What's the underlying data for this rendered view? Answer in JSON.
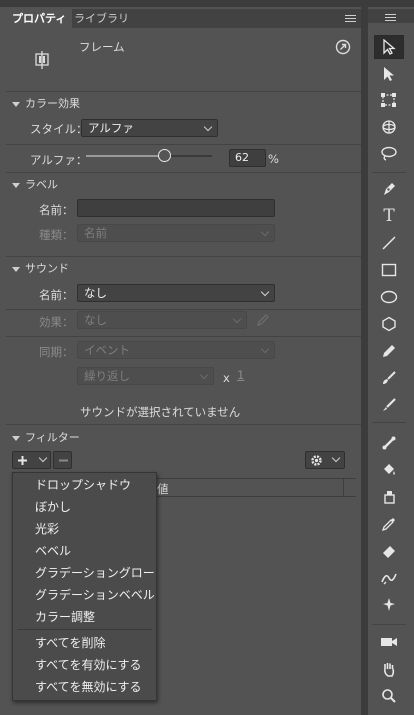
{
  "tabs": [
    {
      "label": "プロパティ"
    },
    {
      "label": "ライブラリ"
    }
  ],
  "header": {
    "object_label": "フレーム"
  },
  "color_effect": {
    "section_title": "カラー効果",
    "style_label": "スタイル：",
    "style_value": "アルファ",
    "alpha_label": "アルファ：",
    "alpha_value": "62",
    "alpha_unit": "%",
    "alpha_fraction": 0.62
  },
  "label_section": {
    "section_title": "ラベル",
    "name_label": "名前：",
    "name_value": "",
    "type_label": "種類：",
    "type_value": "名前"
  },
  "sound": {
    "section_title": "サウンド",
    "name_label": "名前：",
    "name_value": "なし",
    "effect_label": "効果：",
    "effect_value": "なし",
    "sync_label": "同期：",
    "sync_value": "イベント",
    "repeat_value": "繰り返し",
    "repeat_x": "x",
    "repeat_count": "1",
    "status": "サウンドが選択されていません"
  },
  "filters": {
    "section_title": "フィルター",
    "column_value": "値",
    "menu_items": [
      "ドロップシャドウ",
      "ぼかし",
      "光彩",
      "ベベル",
      "グラデーショングロー",
      "グラデーションベベル",
      "カラー調整"
    ],
    "menu_actions": [
      "すべてを削除",
      "すべてを有効にする",
      "すべてを無効にする"
    ]
  },
  "tools": [
    "selection-tool",
    "subselection-tool",
    "free-transform-tool",
    "3d-rotation-tool",
    "lasso-tool",
    "pen-tool",
    "text-tool",
    "line-tool",
    "rectangle-tool",
    "oval-tool",
    "polystar-tool",
    "pencil-tool",
    "paint-brush-tool",
    "brush-tool",
    "bone-tool",
    "paint-bucket-tool",
    "ink-bottle-tool",
    "eyedropper-tool",
    "eraser-tool",
    "width-tool",
    "asset-warp-tool",
    "camera-tool",
    "hand-tool",
    "zoom-tool"
  ]
}
